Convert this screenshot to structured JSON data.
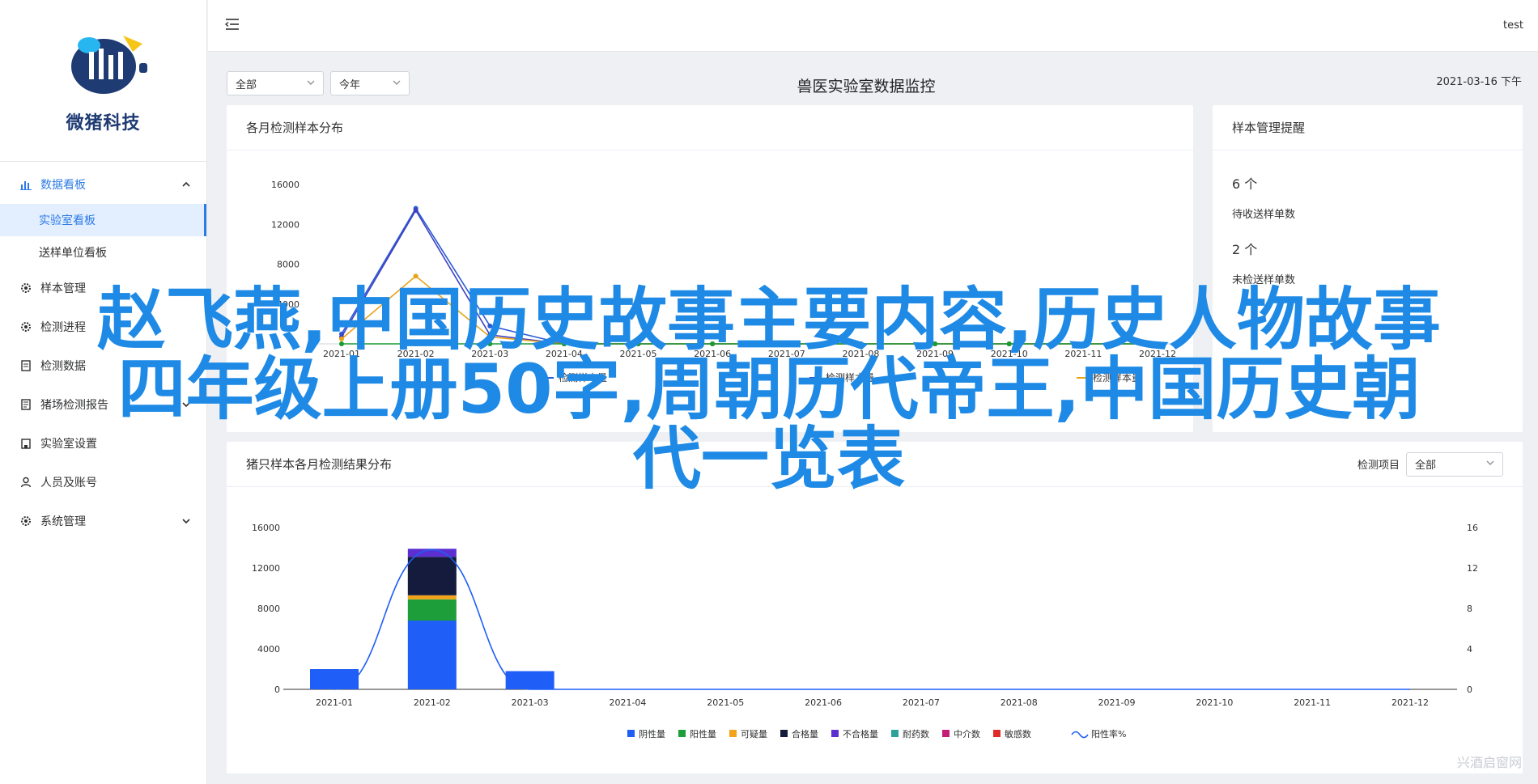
{
  "brand": {
    "name": "微猪科技"
  },
  "user": {
    "name": "test"
  },
  "sidebar": {
    "groups": [
      {
        "label": "数据看板",
        "icon": "chart-icon",
        "expanded": true,
        "children": [
          {
            "label": "实验室看板",
            "active": true
          },
          {
            "label": "送样单位看板",
            "active": false
          }
        ]
      },
      {
        "label": "样本管理",
        "icon": "gear-icon"
      },
      {
        "label": "检测进程",
        "icon": "gear-icon"
      },
      {
        "label": "检测数据",
        "icon": "document-icon"
      },
      {
        "label": "猪场检测报告",
        "icon": "report-icon"
      },
      {
        "label": "实验室设置",
        "icon": "building-icon"
      },
      {
        "label": "人员及账号",
        "icon": "user-icon"
      },
      {
        "label": "系统管理",
        "icon": "gear-icon"
      }
    ]
  },
  "filters": {
    "scope": "全部",
    "period": "今年"
  },
  "page": {
    "title": "兽医实验室数据监控",
    "date": "2021-03-16 下午"
  },
  "panel_monthly": {
    "title": "各月检测样本分布"
  },
  "panel_reminder": {
    "title": "样本管理提醒",
    "pending_count": "6 个",
    "pending_label": "待收送样单数",
    "unreviewed_count": "2 个",
    "unreviewed_label": "未检送样单数"
  },
  "panel_results": {
    "title": "猪只样本各月检测结果分布",
    "filter_label": "检测项目",
    "filter_value": "全部"
  },
  "overlay": {
    "line1": "赵飞燕,中国历史故事主要内容,历史人物故事",
    "line2": "四年级上册50字,周朝历代帝王,中国历史朝",
    "line3": "代一览表"
  },
  "watermark": "兴酒启窗网",
  "chart_data": [
    {
      "type": "line",
      "title": "各月检测样本分布",
      "categories": [
        "2021-01",
        "2021-02",
        "2021-03",
        "2021-04",
        "2021-05",
        "2021-06",
        "2021-07",
        "2021-08",
        "2021-09",
        "2021-10",
        "2021-11",
        "2021-12"
      ],
      "ylim": [
        0,
        16000
      ],
      "yticks": [
        4000,
        8000,
        12000,
        16000
      ],
      "series": [
        {
          "name": "检测样本量",
          "color": "#2a5bd7",
          "values": [
            1000,
            13600,
            1800,
            0,
            0,
            0,
            0,
            0,
            0,
            0,
            0,
            0
          ]
        },
        {
          "name": "检测样本量",
          "color": "#3f3fbf",
          "values": [
            700,
            13400,
            900,
            0,
            0,
            0,
            0,
            0,
            0,
            0,
            0,
            0
          ]
        },
        {
          "name": "检测样本量",
          "color": "#e8a317",
          "values": [
            500,
            6800,
            700,
            0,
            0,
            0,
            0,
            0,
            0,
            0,
            0,
            0
          ]
        },
        {
          "name": "检测样本量",
          "color": "#1a9b32",
          "values": [
            0,
            0,
            0,
            0,
            0,
            0,
            0,
            0,
            0,
            0,
            0,
            0
          ]
        }
      ],
      "legend": [
        "检测样本量",
        "检测样本量",
        "检测样本量"
      ],
      "grid": false
    },
    {
      "type": "bar",
      "title": "猪只样本各月检测结果分布",
      "categories": [
        "2021-01",
        "2021-02",
        "2021-03",
        "2021-04",
        "2021-05",
        "2021-06",
        "2021-07",
        "2021-08",
        "2021-09",
        "2021-10",
        "2021-11",
        "2021-12"
      ],
      "ylim": [
        0,
        16000
      ],
      "yticks": [
        0,
        4000,
        8000,
        12000,
        16000
      ],
      "y2lim": [
        0,
        16
      ],
      "y2ticks": [
        0,
        4,
        8,
        12,
        16
      ],
      "stacked": true,
      "series": [
        {
          "name": "阴性量",
          "color": "#1f5ef7",
          "values": [
            2000,
            6800,
            1800,
            0,
            0,
            0,
            0,
            0,
            0,
            0,
            0,
            0
          ]
        },
        {
          "name": "阳性量",
          "color": "#1d9e3a",
          "values": [
            0,
            2100,
            0,
            0,
            0,
            0,
            0,
            0,
            0,
            0,
            0,
            0
          ]
        },
        {
          "name": "可疑量",
          "color": "#f2a31b",
          "values": [
            0,
            400,
            0,
            0,
            0,
            0,
            0,
            0,
            0,
            0,
            0,
            0
          ]
        },
        {
          "name": "合格量",
          "color": "#141b3c",
          "values": [
            0,
            3800,
            0,
            0,
            0,
            0,
            0,
            0,
            0,
            0,
            0,
            0
          ]
        },
        {
          "name": "不合格量",
          "color": "#5b2fd0",
          "values": [
            0,
            800,
            0,
            0,
            0,
            0,
            0,
            0,
            0,
            0,
            0,
            0
          ]
        },
        {
          "name": "耐药数",
          "color": "#2aa39a",
          "values": [
            0,
            0,
            0,
            0,
            0,
            0,
            0,
            0,
            0,
            0,
            0,
            0
          ]
        },
        {
          "name": "中介数",
          "color": "#c41f78",
          "values": [
            0,
            0,
            0,
            0,
            0,
            0,
            0,
            0,
            0,
            0,
            0,
            0
          ]
        },
        {
          "name": "敏感数",
          "color": "#e02b2b",
          "values": [
            0,
            0,
            0,
            0,
            0,
            0,
            0,
            0,
            0,
            0,
            0,
            0
          ]
        }
      ],
      "line_series": {
        "name": "阳性率%",
        "color": "#1f5ef7",
        "values": [
          0,
          13.8,
          0,
          0,
          0,
          0,
          0,
          0,
          0,
          0,
          0,
          0
        ]
      },
      "grid": false
    }
  ]
}
